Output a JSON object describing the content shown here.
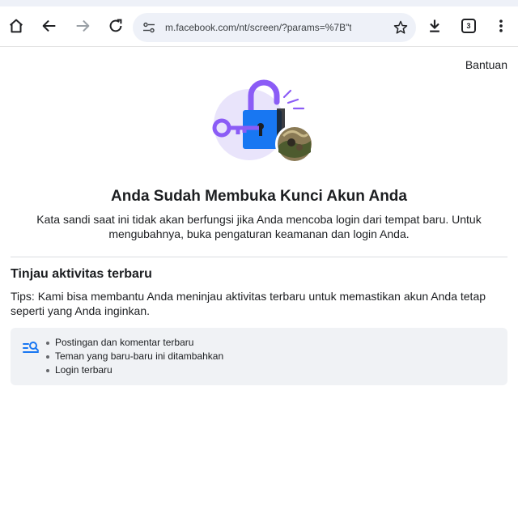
{
  "browser": {
    "url": "m.facebook.com/nt/screen/?params=%7B\"token\"%3",
    "tab_count": "3"
  },
  "header": {
    "help_label": "Bantuan"
  },
  "main": {
    "title": "Anda Sudah Membuka Kunci Akun Anda",
    "subtitle": "Kata sandi saat ini tidak akan berfungsi jika Anda mencoba login dari tempat baru. Untuk mengubahnya, buka pengaturan keamanan dan login Anda."
  },
  "review": {
    "heading": "Tinjau aktivitas terbaru",
    "tips": "Tips: Kami bisa membantu Anda meninjau aktivitas terbaru untuk memastikan akun Anda tetap seperti yang Anda inginkan.",
    "items": [
      "Postingan dan komentar terbaru",
      "Teman yang baru-baru ini ditambahkan",
      "Login terbaru"
    ]
  },
  "icons": {
    "home": "home-icon",
    "back": "arrow-left-icon",
    "forward": "arrow-right-icon",
    "reload": "reload-icon",
    "site_settings": "tune-icon",
    "bookmark": "star-icon",
    "download": "download-icon",
    "tabs": "tab-switcher-icon",
    "menu": "more-vertical-icon",
    "review": "search-list-icon"
  },
  "colors": {
    "accent": "#1877f2",
    "key_purple": "#8b5cf6",
    "circle_bg": "#e9e4fb"
  }
}
